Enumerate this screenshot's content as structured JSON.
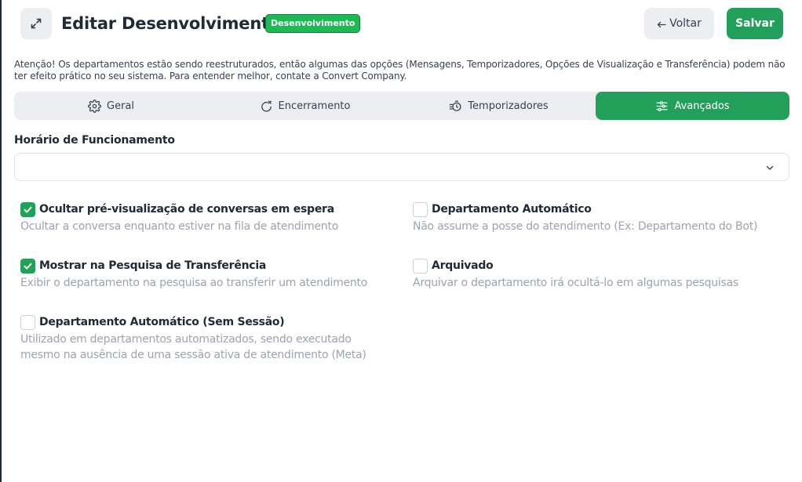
{
  "header": {
    "title": "Editar Desenvolvimento",
    "badge": "Desenvolvimento",
    "back_label": "Voltar",
    "save_label": "Salvar"
  },
  "warning_text": "Atenção! Os departamentos estão sendo reestruturados, então algumas das opções (Mensagens, Temporizadores, Opções de Visualização e Transferência) podem não ter efeito prático no seu sistema. Para entender melhor, contate a Convert Company.",
  "tabs": [
    {
      "label": "Geral",
      "icon": "gear-icon",
      "active": false
    },
    {
      "label": "Encerramento",
      "icon": "rotate-x-icon",
      "active": false
    },
    {
      "label": "Temporizadores",
      "icon": "timer-icon",
      "active": false
    },
    {
      "label": "Avançados",
      "icon": "sliders-icon",
      "active": true
    }
  ],
  "schedule": {
    "label": "Horário de Funcionamento",
    "value": ""
  },
  "options": [
    {
      "label": "Ocultar pré-visualização de conversas em espera",
      "description": "Ocultar a conversa enquanto estiver na fila de atendimento",
      "checked": true
    },
    {
      "label": "Departamento Automático",
      "description": "Não assume a posse do atendimento (Ex: Departamento do Bot)",
      "checked": false
    },
    {
      "label": "Mostrar na Pesquisa de Transferência",
      "description": "Exibir o departamento na pesquisa ao transferir um atendimento",
      "checked": true
    },
    {
      "label": "Arquivado",
      "description": "Arquivar o departamento irá ocultá-lo em algumas pesquisas",
      "checked": false
    },
    {
      "label": "Departamento Automático (Sem Sessão)",
      "description": "Utilizado em departamentos automatizados, sendo executado mesmo na ausência de uma sessão ativa de atendimento (Meta)",
      "checked": false
    }
  ],
  "colors": {
    "accent": "#22a05a",
    "badge": "#1db954"
  }
}
